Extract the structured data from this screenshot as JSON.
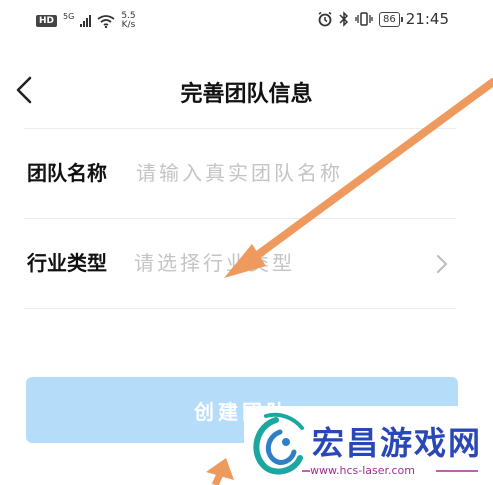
{
  "status_bar": {
    "hd_label": "HD",
    "network_type": "5G",
    "net_speed_value": "5.5",
    "net_speed_unit": "K/s",
    "battery_level": "86",
    "time": "21:45"
  },
  "header": {
    "title": "完善团队信息"
  },
  "form": {
    "team_name_label": "团队名称",
    "team_name_placeholder": "请输入真实团队名称",
    "industry_label": "行业类型",
    "industry_placeholder": "请选择行业类型"
  },
  "create_button_label": "创建团队",
  "watermark": {
    "title": "宏昌游戏网",
    "url": "www.hcs-laser.com"
  },
  "colors": {
    "button_bg": "#b5dcf8",
    "arrow": "#ee9a5e",
    "placeholder": "#c4c4c4",
    "watermark_title": "#2848b8",
    "watermark_url": "#a03090"
  }
}
